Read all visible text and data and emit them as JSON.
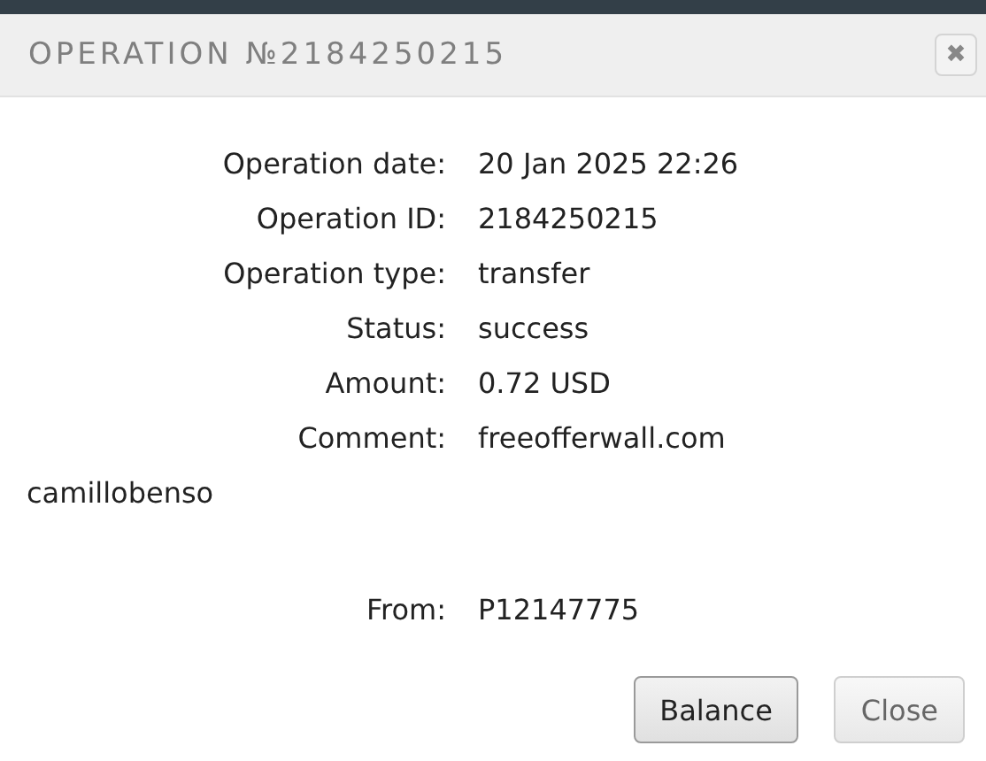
{
  "dialog": {
    "title": "OPERATION №2184250215",
    "close_icon": "✖"
  },
  "fields": [
    {
      "label": "Operation date:",
      "value": "20 Jan 2025 22:26"
    },
    {
      "label": "Operation ID:",
      "value": "2184250215"
    },
    {
      "label": "Operation type:",
      "value": "transfer"
    },
    {
      "label": "Status:",
      "value": "success"
    },
    {
      "label": "Amount:",
      "value": "0.72 USD"
    },
    {
      "label": "Comment:",
      "value": "freeofferwall.com",
      "continuation": "camillobenso"
    },
    {
      "label": "From:",
      "value": "P12147775"
    }
  ],
  "buttons": [
    {
      "label": "Balance",
      "focused": true
    },
    {
      "label": "Close",
      "focused": false
    }
  ]
}
